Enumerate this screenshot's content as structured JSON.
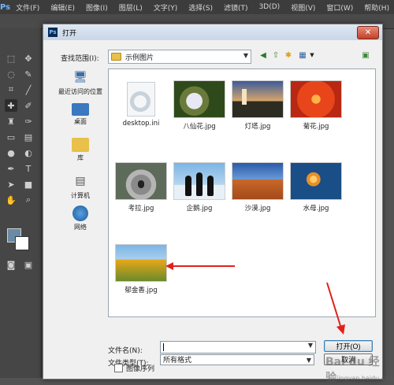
{
  "app": {
    "logo": "Ps",
    "menu": [
      "文件(F)",
      "编辑(E)",
      "图像(I)",
      "图层(L)",
      "文字(Y)",
      "选择(S)",
      "滤镜(T)",
      "3D(D)",
      "视图(V)",
      "窗口(W)",
      "帮助(H)"
    ]
  },
  "dialog": {
    "logo": "Ps",
    "title": "打开",
    "close": "✕",
    "look_in_label": "查找范围(I):",
    "look_in_value": "示例图片",
    "places": [
      {
        "label": "最近访问的位置",
        "icon": "recent-places-icon"
      },
      {
        "label": "桌面",
        "icon": "desktop-icon"
      },
      {
        "label": "库",
        "icon": "library-icon"
      },
      {
        "label": "计算机",
        "icon": "computer-icon"
      },
      {
        "label": "网络",
        "icon": "network-icon"
      }
    ],
    "files": [
      {
        "name": "desktop.ini"
      },
      {
        "name": "八仙花.jpg"
      },
      {
        "name": "灯塔.jpg"
      },
      {
        "name": "菊花.jpg"
      },
      {
        "name": "考拉.jpg"
      },
      {
        "name": "企鹅.jpg"
      },
      {
        "name": "沙漠.jpg"
      },
      {
        "name": "水母.jpg"
      },
      {
        "name": "郁金香.jpg"
      }
    ],
    "filename_label": "文件名(N):",
    "filename_value": "",
    "filetype_label": "文件类型(T):",
    "filetype_value": "所有格式",
    "open_button": "打开(O)",
    "cancel_button": "取消",
    "image_sequence_label": "图像序列"
  },
  "watermark": {
    "text": "Bai du 经验",
    "sub": "jingyan.baidu.com"
  },
  "colors": {
    "arrow": "#e0211b",
    "accent": "#3c7fb1"
  }
}
